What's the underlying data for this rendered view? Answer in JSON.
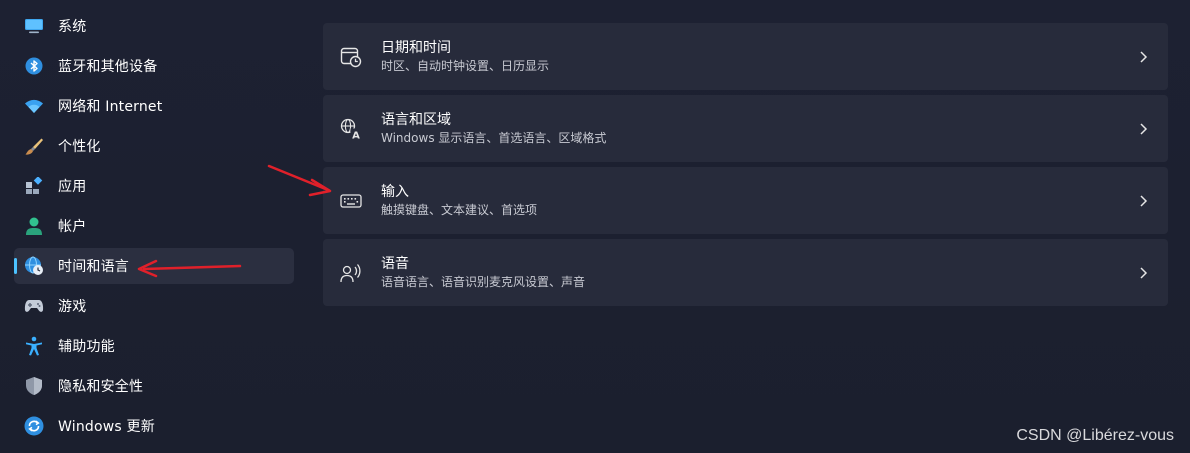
{
  "sidebar": {
    "items": [
      {
        "label": "系统",
        "icon": "monitor-icon"
      },
      {
        "label": "蓝牙和其他设备",
        "icon": "bluetooth-icon"
      },
      {
        "label": "网络和 Internet",
        "icon": "wifi-icon"
      },
      {
        "label": "个性化",
        "icon": "brush-icon"
      },
      {
        "label": "应用",
        "icon": "apps-icon"
      },
      {
        "label": "帐户",
        "icon": "account-icon"
      },
      {
        "label": "时间和语言",
        "icon": "globe-clock-icon",
        "selected": true
      },
      {
        "label": "游戏",
        "icon": "gamepad-icon"
      },
      {
        "label": "辅助功能",
        "icon": "accessibility-icon"
      },
      {
        "label": "隐私和安全性",
        "icon": "shield-icon"
      },
      {
        "label": "Windows 更新",
        "icon": "update-icon"
      }
    ]
  },
  "main": {
    "cards": [
      {
        "title": "日期和时间",
        "subtitle": "时区、自动时钟设置、日历显示",
        "icon": "calendar-clock-icon"
      },
      {
        "title": "语言和区域",
        "subtitle": "Windows 显示语言、首选语言、区域格式",
        "icon": "language-icon"
      },
      {
        "title": "输入",
        "subtitle": "触摸键盘、文本建议、首选项",
        "icon": "keyboard-icon"
      },
      {
        "title": "语音",
        "subtitle": "语音语言、语音识别麦克风设置、声音",
        "icon": "speech-icon"
      }
    ]
  },
  "watermark": "CSDN @Libérez-vous",
  "colors": {
    "accent": "#4cc2ff",
    "annotation_arrow": "#e0202a",
    "background": "#1c2030",
    "card": "#272b3b",
    "selected_item": "#2b2f40"
  }
}
